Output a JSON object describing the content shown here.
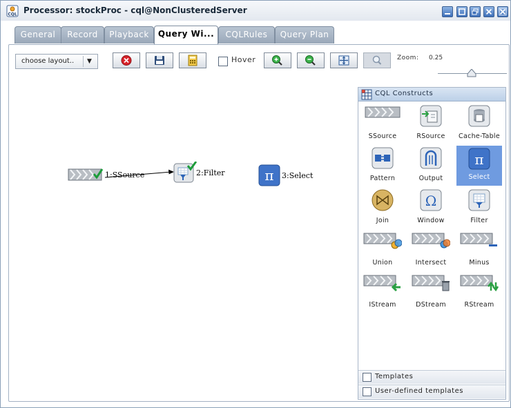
{
  "window": {
    "title": "Processor: stockProc - cql@NonClusteredServer",
    "icon": "cql-app-icon",
    "icon_text": "CQL",
    "controls": [
      "minimize-icon",
      "maximize-icon",
      "restore-icon",
      "close-icon",
      "close-all-icon"
    ]
  },
  "tabs": [
    {
      "label": "General",
      "active": false
    },
    {
      "label": "Record",
      "active": false
    },
    {
      "label": "Playback",
      "active": false
    },
    {
      "label": "Query Wi...",
      "active": true
    },
    {
      "label": "CQLRules",
      "active": false
    },
    {
      "label": "Query Plan",
      "active": false
    }
  ],
  "toolbar": {
    "layout_select": "choose layout..",
    "buttons": [
      "delete-icon",
      "save-icon",
      "calculator-icon",
      "zoom-in-icon",
      "zoom-out-icon",
      "fit-icon",
      "search-icon"
    ],
    "hover_label": "Hover",
    "hover_checked": false,
    "zoom_label": "Zoom:",
    "zoom_value": "0.25"
  },
  "canvas": {
    "nodes": [
      {
        "label": "1:SSource",
        "icon": "stream-source-icon"
      },
      {
        "label": "2:Filter",
        "icon": "filter-icon"
      },
      {
        "label": "3:Select",
        "icon": "pi-select-icon"
      }
    ],
    "edges": [
      {
        "from": "1:SSource",
        "to": "2:Filter"
      }
    ]
  },
  "palette": {
    "title": "CQL Constructs",
    "items": [
      {
        "label": "SSource",
        "icon": "ssource-icon"
      },
      {
        "label": "RSource",
        "icon": "rsource-icon"
      },
      {
        "label": "Cache-Table",
        "icon": "cache-table-icon"
      },
      {
        "label": "Pattern",
        "icon": "pattern-icon"
      },
      {
        "label": "Output",
        "icon": "output-icon"
      },
      {
        "label": "Select",
        "icon": "select-pi-icon",
        "selected": true
      },
      {
        "label": "Join",
        "icon": "join-icon"
      },
      {
        "label": "Window",
        "icon": "window-omega-icon"
      },
      {
        "label": "Filter",
        "icon": "filter-icon"
      },
      {
        "label": "Union",
        "icon": "union-icon"
      },
      {
        "label": "Intersect",
        "icon": "intersect-icon"
      },
      {
        "label": "Minus",
        "icon": "minus-icon"
      },
      {
        "label": "IStream",
        "icon": "istream-icon"
      },
      {
        "label": "DStream",
        "icon": "dstream-icon"
      },
      {
        "label": "RStream",
        "icon": "rstream-icon"
      }
    ],
    "footer": [
      {
        "label": "Templates"
      },
      {
        "label": "User-defined templates"
      }
    ]
  },
  "colors": {
    "accent": "#3f73c8",
    "selected_bg": "#6f9be0",
    "tab_inactive": "#a6b3c4",
    "delete_red": "#d8232a"
  }
}
